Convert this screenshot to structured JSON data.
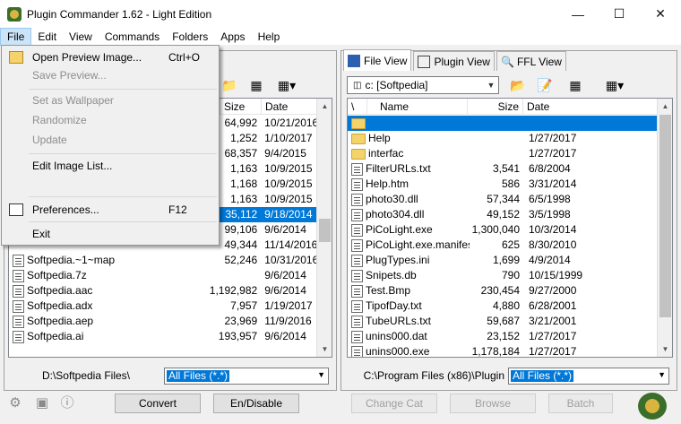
{
  "window": {
    "title": "Plugin Commander 1.62 - Light Edition",
    "controls": [
      "minimize",
      "maximize",
      "close"
    ]
  },
  "menubar": [
    "File",
    "Edit",
    "View",
    "Commands",
    "Folders",
    "Apps",
    "Help"
  ],
  "file_menu": {
    "items": [
      {
        "label": "Open Preview Image...",
        "shortcut": "Ctrl+O",
        "enabled": true,
        "icon": "open-folder-icon"
      },
      {
        "label": "Save Preview...",
        "shortcut": "",
        "enabled": false
      },
      {
        "label": "Set as Wallpaper",
        "shortcut": "",
        "enabled": false
      },
      {
        "label": "Randomize",
        "shortcut": "",
        "enabled": false
      },
      {
        "label": "Update",
        "shortcut": "",
        "enabled": false
      },
      {
        "label": "Edit Image List...",
        "shortcut": "",
        "enabled": true
      },
      {
        "label": "Preferences...",
        "shortcut": "F12",
        "enabled": true,
        "icon": "preferences-icon"
      },
      {
        "label": "Exit",
        "shortcut": "",
        "enabled": true
      }
    ]
  },
  "left_pane": {
    "columns": [
      "Size",
      "Date"
    ],
    "rows_partial": [
      {
        "size": "64,992",
        "date": "10/21/2016"
      },
      {
        "size": "1,252",
        "date": "1/10/2017"
      },
      {
        "size": "68,357",
        "date": "9/4/2015"
      },
      {
        "size": "1,163",
        "date": "10/9/2015"
      },
      {
        "size": "1,168",
        "date": "10/9/2015"
      },
      {
        "size": "1,163",
        "date": "10/9/2015"
      },
      {
        "size": "35,112",
        "date": "9/18/2014",
        "selected": true
      },
      {
        "size": "99,106",
        "date": "9/6/2014"
      },
      {
        "size": "49,344",
        "date": "11/14/2016"
      }
    ],
    "rows": [
      {
        "name": "Softpedia.~1~map",
        "size": "52,246",
        "date": "10/31/2016"
      },
      {
        "name": "Softpedia.7z",
        "size": "",
        "date": "9/6/2014"
      },
      {
        "name": "Softpedia.aac",
        "size": "1,192,982",
        "date": "9/6/2014"
      },
      {
        "name": "Softpedia.adx",
        "size": "7,957",
        "date": "1/19/2017"
      },
      {
        "name": "Softpedia.aep",
        "size": "23,969",
        "date": "11/9/2016"
      },
      {
        "name": "Softpedia.ai",
        "size": "193,957",
        "date": "9/6/2014"
      }
    ],
    "path": "D:\\Softpedia Files\\",
    "filter": "All Files (*.*)"
  },
  "right_pane": {
    "tabs": [
      "File View",
      "Plugin View",
      "FFL View"
    ],
    "drive": "c: [Softpedia]",
    "columns": [
      "\\",
      "Name",
      "Size",
      "Date"
    ],
    "rows": [
      {
        "name": "",
        "size": "",
        "date": "",
        "type": "up",
        "selected": true
      },
      {
        "name": "Help",
        "size": "",
        "date": "1/27/2017",
        "type": "folder"
      },
      {
        "name": "interfac",
        "size": "",
        "date": "1/27/2017",
        "type": "folder"
      },
      {
        "name": "FilterURLs.txt",
        "size": "3,541",
        "date": "6/8/2004",
        "type": "file"
      },
      {
        "name": "Help.htm",
        "size": "586",
        "date": "3/31/2014",
        "type": "file"
      },
      {
        "name": "photo30.dll",
        "size": "57,344",
        "date": "6/5/1998",
        "type": "file"
      },
      {
        "name": "photo304.dll",
        "size": "49,152",
        "date": "3/5/1998",
        "type": "file"
      },
      {
        "name": "PiCoLight.exe",
        "size": "1,300,040",
        "date": "10/3/2014",
        "type": "file"
      },
      {
        "name": "PiCoLight.exe.manifest",
        "size": "625",
        "date": "8/30/2010",
        "type": "file"
      },
      {
        "name": "PlugTypes.ini",
        "size": "1,699",
        "date": "4/9/2014",
        "type": "file"
      },
      {
        "name": "Snipets.db",
        "size": "790",
        "date": "10/15/1999",
        "type": "file"
      },
      {
        "name": "Test.Bmp",
        "size": "230,454",
        "date": "9/27/2000",
        "type": "file"
      },
      {
        "name": "TipofDay.txt",
        "size": "4,880",
        "date": "6/28/2001",
        "type": "file"
      },
      {
        "name": "TubeURLs.txt",
        "size": "59,687",
        "date": "3/21/2001",
        "type": "file"
      },
      {
        "name": "unins000.dat",
        "size": "23,152",
        "date": "1/27/2017",
        "type": "file"
      },
      {
        "name": "unins000.exe",
        "size": "1,178,184",
        "date": "1/27/2017",
        "type": "file"
      }
    ],
    "path": "C:\\Program Files (x86)\\Plugin",
    "filter": "All Files (*.*)"
  },
  "bottom_buttons": [
    {
      "label": "Convert",
      "enabled": true
    },
    {
      "label": "En/Disable",
      "enabled": true
    },
    {
      "label": "Change Cat",
      "enabled": false
    },
    {
      "label": "Browse",
      "enabled": false
    },
    {
      "label": "Batch",
      "enabled": false
    }
  ],
  "colors": {
    "selection": "#0078d7",
    "menu_highlight": "#cce4f7"
  }
}
